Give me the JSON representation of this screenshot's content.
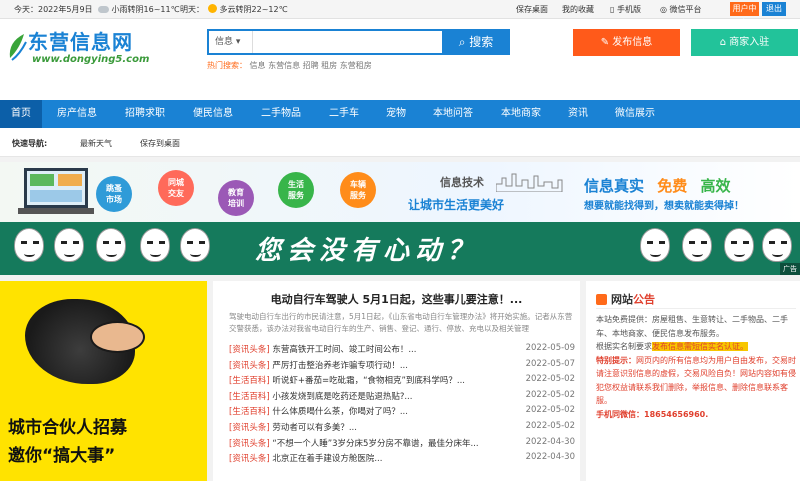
{
  "topbar": {
    "today_label": "今天：",
    "today_date": "2022年5月9日",
    "today_weather": "小雨转阴16~11℃",
    "tomorrow_label": "明天：",
    "tomorrow_weather": "多云转阴22~12℃",
    "links": [
      "保存桌面",
      "我的收藏",
      "手机版",
      "微信平台"
    ],
    "user_center": "用户中心",
    "logout": "退出"
  },
  "header": {
    "logo_text": "东营信息网",
    "logo_url": "www.dongying5.com",
    "search_select": "信息",
    "search_placeholder": "",
    "search_button": "搜索",
    "hot_label": "热门搜索：",
    "hot_keywords": "信息 东营信息 招聘 租房 东营租房",
    "publish_button": "发布信息",
    "merchant_button": "商家入驻"
  },
  "nav": [
    "首页",
    "房产信息",
    "招聘求职",
    "便民信息",
    "二手物品",
    "二手车",
    "宠物",
    "本地问答",
    "本地商家",
    "资讯",
    "微信展示"
  ],
  "quick": {
    "label": "快速导航:",
    "links": [
      "最新天气",
      "保存到桌面"
    ]
  },
  "banner1": {
    "circles": [
      "跳蚤\n市场",
      "同城\n交友",
      "教育\n培训",
      "生活\n服务",
      "车辆\n服务"
    ],
    "circle_colors": [
      "#2f9bd8",
      "#ff6a5a",
      "#9b59b6",
      "#38b54a",
      "#ff8c1a"
    ],
    "slogan_top": "信息技术",
    "slogan_main": "让城市生活更美好",
    "right_1": "信息真实",
    "right_2": "免费",
    "right_3": "高效",
    "right_sub": "想要就能找得到，想卖就能卖得掉！"
  },
  "banner2": {
    "text": "您会没有心动？",
    "ad": "广告"
  },
  "partner": {
    "line1": "城市合伙人招募",
    "line2": "邀你“搞大事”"
  },
  "news": {
    "headline": "电动自行车驾驶人 5月1日起，这些事儿要注意！...",
    "summary": "驾驶电动自行车出行的市民请注意，5月1日起，《山东省电动自行车管理办法》将开始实施。记者从东营交警获悉，该办法对我省电动自行车的生产、销售、登记、通行、停放、充电以及相关管理",
    "items": [
      {
        "cat": "[资讯头条]",
        "title": "东营高铁开工时间、竣工时间公布！...",
        "date": "2022-05-09"
      },
      {
        "cat": "[资讯头条]",
        "title": "严厉打击整治养老诈骗专项行动！...",
        "date": "2022-05-07"
      },
      {
        "cat": "[生活百科]",
        "title": "听说虾+番茄=吃砒霜，“食物相克”到底科学吗？...",
        "date": "2022-05-02"
      },
      {
        "cat": "[生活百科]",
        "title": "小孩发烧到底是吃药还是贴退热贴?...",
        "date": "2022-05-02"
      },
      {
        "cat": "[生活百科]",
        "title": "什么体质喝什么茶，你喝对了吗？...",
        "date": "2022-05-02"
      },
      {
        "cat": "[资讯头条]",
        "title": "劳动者可以有多美？...",
        "date": "2022-05-02"
      },
      {
        "cat": "[资讯头条]",
        "title": "“不想一个人睡”3岁分床5岁分房不靠谱，最佳分床年...",
        "date": "2022-04-30"
      },
      {
        "cat": "[资讯头条]",
        "title": "北京正在着手建设方舱医院...",
        "date": "2022-04-30"
      }
    ]
  },
  "notice": {
    "title_1": "网站",
    "title_2": "公告",
    "p1": "本站免费提供：房屋租售、生意转让、二手物品、二手车、本地商家、便民信息发布服务。",
    "p2_pre": "根据实名制要求",
    "p2_hl": "发布信息需短信实名认证。",
    "p3_label": "特别提示：",
    "p3": "网页内的所有信息均为用户自由发布，交易时请注意识别信息的虚假，交易风险自负！网站内容如有侵犯您权益请联系我们删除，举报信息、删除信息联系客服。",
    "phone_label": "手机同微信：",
    "phone": "18654656960."
  }
}
